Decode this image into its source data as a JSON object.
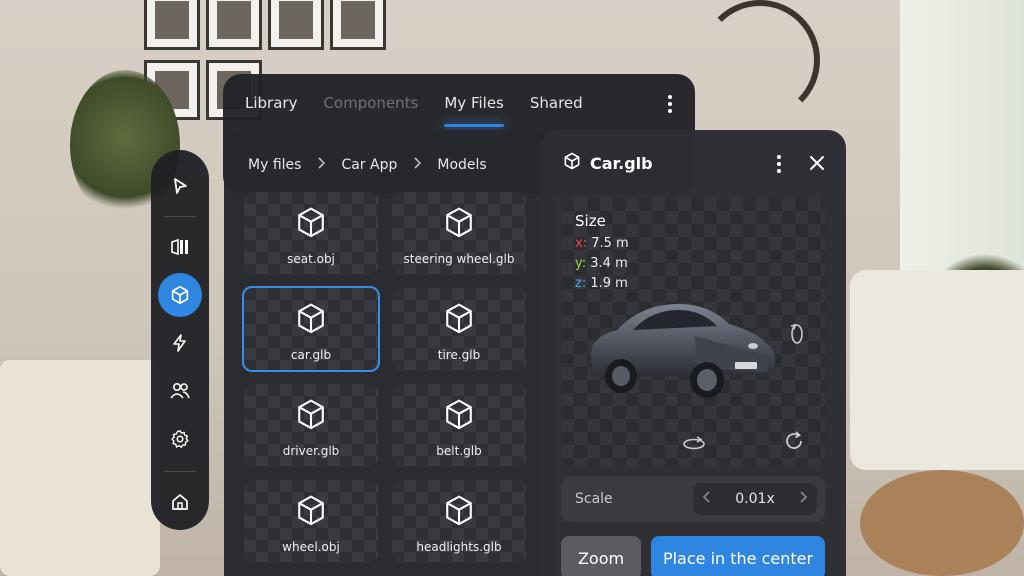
{
  "tabs": [
    {
      "label": "Library",
      "state": "normal"
    },
    {
      "label": "Components",
      "state": "dim"
    },
    {
      "label": "My Files",
      "state": "active"
    },
    {
      "label": "Shared",
      "state": "normal"
    }
  ],
  "rail": {
    "items": [
      "pointer-icon",
      "panels-icon",
      "cube-icon",
      "bolt-icon",
      "people-icon",
      "gear-icon",
      "home-icon"
    ],
    "active": "cube-icon"
  },
  "breadcrumb": [
    "My files",
    "Car App",
    "Models"
  ],
  "files": [
    {
      "name": "seat.obj"
    },
    {
      "name": "steering wheel.glb"
    },
    {
      "name": "car.glb",
      "selected": true
    },
    {
      "name": "tire.glb"
    },
    {
      "name": "driver.glb"
    },
    {
      "name": "belt.glb"
    },
    {
      "name": "wheel.obj"
    },
    {
      "name": "headlights.glb"
    }
  ],
  "detail": {
    "title": "Car.glb",
    "size_label": "Size",
    "x_label": "x:",
    "x_value": "7.5 m",
    "y_label": "y:",
    "y_value": "3.4 m",
    "z_label": "z:",
    "z_value": "1.9 m",
    "scale_label": "Scale",
    "scale_value": "0.01x",
    "zoom_label": "Zoom",
    "place_label": "Place in the center"
  },
  "colors": {
    "accent": "#2f86e0",
    "x_axis": "#f04a4a",
    "y_axis": "#9ed84a",
    "z_axis": "#4aa6f0"
  }
}
